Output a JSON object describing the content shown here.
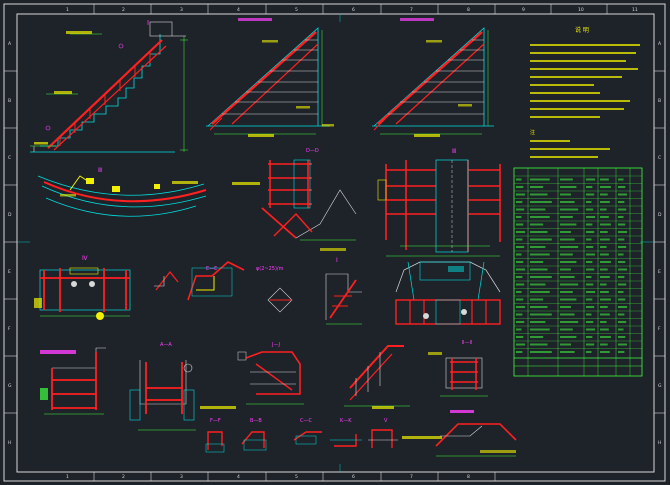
{
  "drawing": {
    "background_color": "#1e2229",
    "frame_color": "#d8d8d8",
    "outline_color": "#00e0e0",
    "cut_color": "#ff2020",
    "label_color": "#ff40ff",
    "dimension_color": "#40ff40",
    "note_color": "#f0f000",
    "border_numbers": [
      "1",
      "2",
      "3",
      "4",
      "5",
      "6",
      "7",
      "8",
      "9",
      "10",
      "11"
    ],
    "border_letters": [
      "A",
      "B",
      "C",
      "D",
      "E",
      "F",
      "G",
      "H"
    ],
    "view_labels": {
      "v1": "Ⅰ",
      "v2": "Ⅱ",
      "v3": "Ⅲ",
      "v4": "Ⅳ",
      "v5": "Ⅴ",
      "dd": "D—D",
      "ee": "E—E",
      "aa": "A—A",
      "jj": "J—J",
      "bb": "B—B",
      "cc": "C—C",
      "ff": "F—F",
      "kk": "K—K",
      "ii": "Ⅱ—Ⅱ",
      "detail": "φ(2~25)/m"
    },
    "notes_title": "说 明",
    "section_note": "注"
  }
}
